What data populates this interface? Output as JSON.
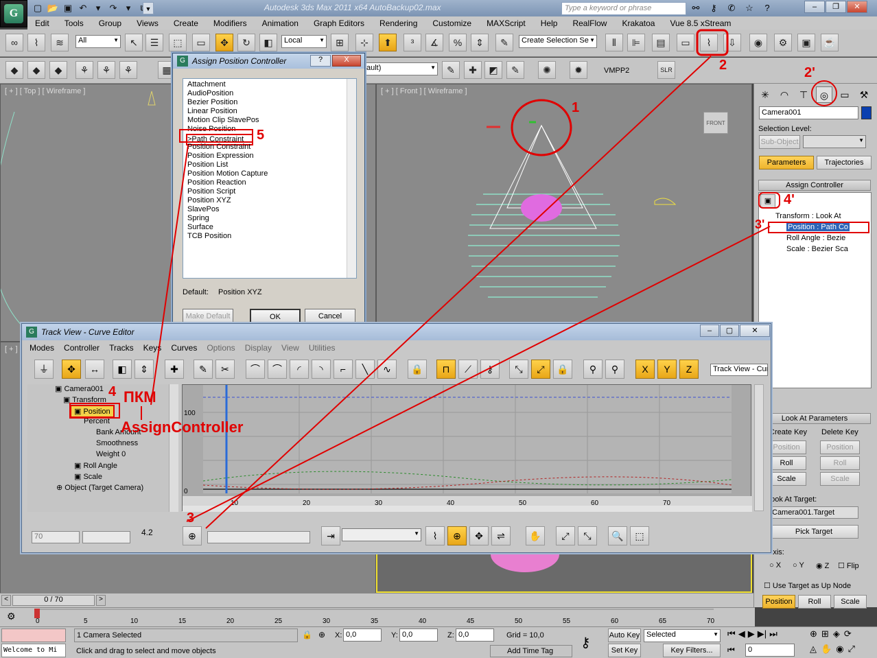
{
  "app": {
    "logo": "3ds Max logo",
    "title": "Autodesk 3ds Max  2011 x64      AutoBackup02.max",
    "search_placeholder": "Type a keyword or phrase",
    "window_controls": [
      "minimize",
      "restore",
      "close"
    ]
  },
  "menubar": {
    "items": [
      "Edit",
      "Tools",
      "Group",
      "Views",
      "Create",
      "Modifiers",
      "Animation",
      "Graph Editors",
      "Rendering",
      "Customize",
      "MAXScript",
      "Help",
      "RealFlow",
      "Krakatoa",
      "Vue 8.5 xStream"
    ]
  },
  "toolbar": {
    "selection_filter": "All",
    "coord_system": "Local",
    "named_selection": "Create Selection Se",
    "scene_dropdown": "ault)",
    "vmpp_label": "VMPP2",
    "slr_label": "SLR"
  },
  "viewports": {
    "top_label": "[ + ] [ Top ] [ Wireframe ]",
    "front_label": "[ + ] [ Front ] [ Wireframe ]",
    "persp_label": "[ + ]",
    "viewcube_front": "FRONT"
  },
  "command_panel": {
    "object_name": "Camera001",
    "object_color": "#0a3fb0",
    "selection_level_label": "Selection Level:",
    "subobject_button": "Sub-Object",
    "parameters_tab": "Parameters",
    "trajectories_tab": "Trajectories",
    "assign_controller_rollout": "Assign Controller",
    "tree": [
      "Transform : Look At",
      "Position : Path Co",
      "Roll Angle : Bezie",
      "Scale : Bezier Sca"
    ],
    "look_at_rollout": "Look At Parameters",
    "create_key_label": "Create Key",
    "delete_key_label": "Delete Key",
    "create_buttons": [
      "Position",
      "Roll",
      "Scale"
    ],
    "delete_buttons": [
      "Position",
      "Roll",
      "Scale"
    ],
    "look_at_target_label": "Look At Target:",
    "target_value": "Camera001.Target",
    "pick_target_button": "Pick Target",
    "axis_label": "Axis:",
    "axis_options": [
      "X",
      "Y",
      "Z"
    ],
    "axis_selected": "Z",
    "flip_label": "Flip",
    "use_target_up_label": "Use Target as Up Node",
    "bottom_buttons": [
      "Position",
      "Roll",
      "Scale"
    ]
  },
  "dialog": {
    "title": "Assign Position Controller",
    "help_button": "?",
    "close_button": "X",
    "items": [
      "Attachment",
      "AudioPosition",
      "Bezier Position",
      "Linear Position",
      "Motion Clip SlavePos",
      "Noise Position",
      ">Path Constraint",
      "Position Constraint",
      "Position Expression",
      "Position List",
      "Position Motion Capture",
      "Position Reaction",
      "Position Script",
      "Position XYZ",
      "SlavePos",
      "Spring",
      "Surface",
      "TCB Position"
    ],
    "default_label": "Default:",
    "default_value": "Position XYZ",
    "make_default_button": "Make Default",
    "ok_button": "OK",
    "cancel_button": "Cancel"
  },
  "trackview": {
    "title": "Track View - Curve Editor",
    "menu": [
      "Modes",
      "Controller",
      "Tracks",
      "Keys",
      "Curves",
      "Options",
      "Display",
      "View",
      "Utilities"
    ],
    "view_name": "Track View - Cur",
    "tree": [
      "Camera001",
      "Transform",
      "Position",
      "Percent",
      "Bank Amount",
      "Smoothness",
      "Weight 0",
      "Roll Angle",
      "Scale",
      "Object (Target Camera)"
    ],
    "y_labels": [
      "100",
      "0"
    ],
    "x_labels": [
      "10",
      "20",
      "30",
      "40",
      "50",
      "60",
      "70"
    ],
    "frame_field": "70",
    "key_value": "4.2"
  },
  "annotations": {
    "n1": "1",
    "n2": "2",
    "n2b": "2'",
    "n3": "3",
    "n3b": "3'",
    "n4": "4",
    "n4b": "4'",
    "n5": "5",
    "pkm": "ПКМ",
    "assign": "AssignController"
  },
  "timeline": {
    "frame_counter": "0 / 70",
    "ticks": [
      "0",
      "5",
      "10",
      "15",
      "20",
      "25",
      "30",
      "35",
      "40",
      "45",
      "50",
      "55",
      "60",
      "65",
      "70"
    ]
  },
  "status": {
    "welcome": "Welcome to Mi",
    "selected_count": "1 Camera Selected",
    "prompt": "Click and drag to select and move objects",
    "x_label": "X:",
    "x_value": "0,0",
    "y_label": "Y:",
    "y_value": "0,0",
    "z_label": "Z:",
    "z_value": "0,0",
    "grid": "Grid = 10,0",
    "add_time_tag": "Add Time Tag",
    "auto_key": "Auto Key",
    "set_key": "Set Key",
    "key_mode": "Selected",
    "key_filters": "Key Filters...",
    "current_frame": "0"
  }
}
